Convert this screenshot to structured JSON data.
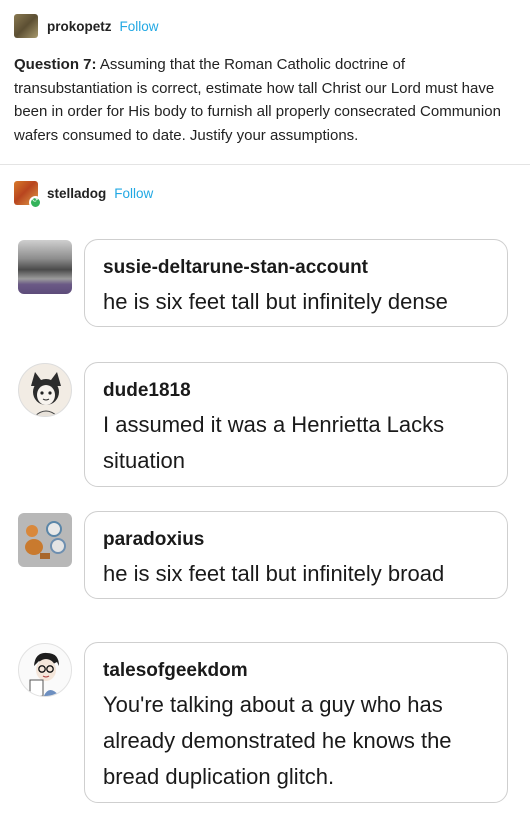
{
  "original_post": {
    "username": "prokopetz",
    "follow_label": "Follow",
    "question_label": "Question 7:",
    "question_text": "Assuming that the Roman Catholic doctrine of transubstantiation is correct, estimate how tall Christ our Lord must have been in order for His body to furnish all properly consecrated Communion wafers consumed to date. Justify your assumptions."
  },
  "reblog": {
    "username": "stelladog",
    "follow_label": "Follow"
  },
  "comments": [
    {
      "username": "susie-deltarune-stan-account",
      "text": "he is six feet tall but infinitely dense"
    },
    {
      "username": "dude1818",
      "text": "I assumed it was a Henrietta Lacks situation"
    },
    {
      "username": "paradoxius",
      "text": "he is six feet tall but infinitely broad"
    },
    {
      "username": "talesofgeekdom",
      "text": "You're talking about a guy who has already demonstrated he knows the bread duplication glitch."
    }
  ],
  "colors": {
    "follow": "#22a8e3",
    "bubble_border": "#cfcfcf",
    "reblog_badge": "#34b35a"
  }
}
